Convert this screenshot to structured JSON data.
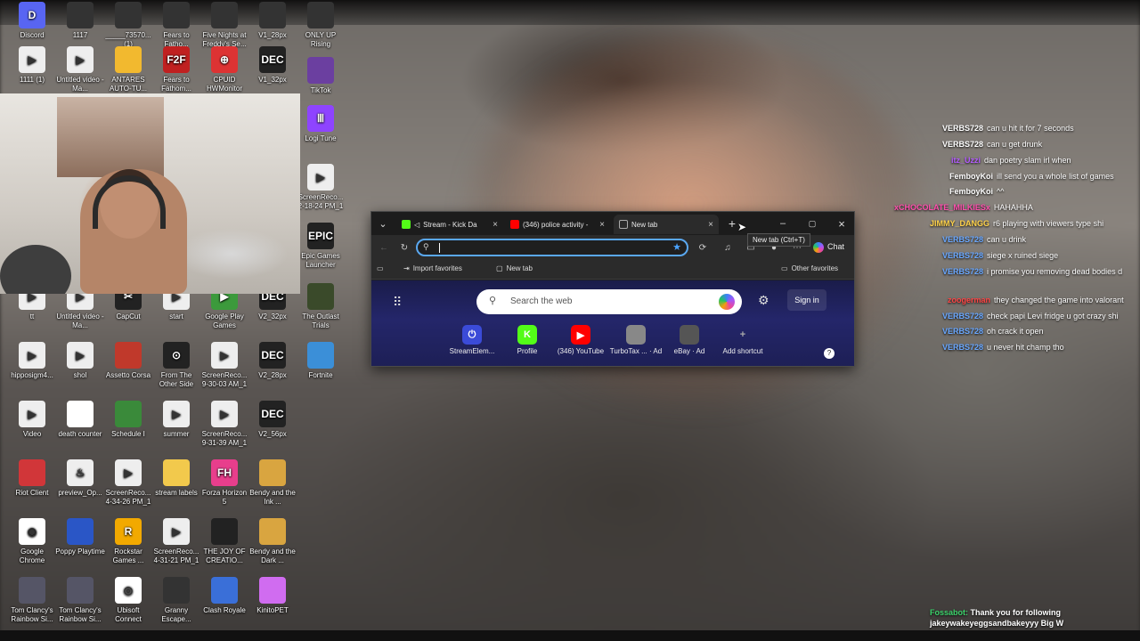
{
  "desktop": {
    "icons": [
      {
        "label": "Discord",
        "color": "#5865f2",
        "glyph": "D"
      },
      {
        "label": "1117",
        "color": "#333",
        "glyph": ""
      },
      {
        "label": "_____73570... (1)",
        "color": "#333",
        "glyph": ""
      },
      {
        "label": "Fears to Fatho...",
        "color": "#333",
        "glyph": ""
      },
      {
        "label": "Five Nights at Freddy's Se...",
        "color": "#333",
        "glyph": ""
      },
      {
        "label": "V1_28px",
        "color": "#333",
        "glyph": ""
      },
      {
        "label": "ONLY UP Rising",
        "color": "#333",
        "glyph": ""
      },
      {
        "label": "1111 (1)",
        "color": "#eee",
        "glyph": "▶"
      },
      {
        "label": "Untitled video - Ma...",
        "color": "#eee",
        "glyph": "▶"
      },
      {
        "label": "ANTARES AUTO-TU...",
        "color": "#f2b92f",
        "glyph": ""
      },
      {
        "label": "Fears to Fathom...",
        "color": "#c02020",
        "glyph": "F2F"
      },
      {
        "label": "CPUID HWMonitor",
        "color": "#d33",
        "glyph": "⊕"
      },
      {
        "label": "V1_32px",
        "color": "#222",
        "glyph": "DEC"
      },
      {
        "label": "TikTok",
        "color": "#6b3fa0",
        "glyph": ""
      },
      {
        "label": "Logi Tune",
        "color": "#8e44ff",
        "glyph": "Ⅲ"
      },
      {
        "label": "ScreenReco... 2-18-24 PM_1",
        "color": "#eee",
        "glyph": "▶"
      },
      {
        "label": "Epic Games Launcher",
        "color": "#222",
        "glyph": "EPIC"
      },
      {
        "label": "tt",
        "color": "#eee",
        "glyph": "▶"
      },
      {
        "label": "Untitled video - Ma...",
        "color": "#eee",
        "glyph": "▶"
      },
      {
        "label": "CapCut",
        "color": "#222",
        "glyph": "✂"
      },
      {
        "label": "start",
        "color": "#eee",
        "glyph": "▶"
      },
      {
        "label": "Google Play Games",
        "color": "#3c9a3c",
        "glyph": "▶"
      },
      {
        "label": "V2_32px",
        "color": "#222",
        "glyph": "DEC"
      },
      {
        "label": "The Outlast Trials",
        "color": "#3a4a2a",
        "glyph": ""
      },
      {
        "label": "hipposigm4...",
        "color": "#eee",
        "glyph": "▶"
      },
      {
        "label": "shol",
        "color": "#eee",
        "glyph": "▶"
      },
      {
        "label": "Assetto Corsa",
        "color": "#c0392b",
        "glyph": ""
      },
      {
        "label": "From The Other Side",
        "color": "#222",
        "glyph": "⊙"
      },
      {
        "label": "ScreenReco... 9-30-03 AM_1",
        "color": "#eee",
        "glyph": "▶"
      },
      {
        "label": "V2_28px",
        "color": "#222",
        "glyph": "DEC"
      },
      {
        "label": "Fortnite",
        "color": "#3b8fd8",
        "glyph": ""
      },
      {
        "label": "Video",
        "color": "#eee",
        "glyph": "▶"
      },
      {
        "label": "death counter",
        "color": "#fff",
        "glyph": ""
      },
      {
        "label": "Schedule I",
        "color": "#3a8a3a",
        "glyph": ""
      },
      {
        "label": "summer",
        "color": "#eee",
        "glyph": "▶"
      },
      {
        "label": "ScreenReco... 9-31-39 AM_1",
        "color": "#eee",
        "glyph": "▶"
      },
      {
        "label": "V2_56px",
        "color": "#222",
        "glyph": "DEC"
      },
      {
        "label": "Riot Client",
        "color": "#d13639",
        "glyph": ""
      },
      {
        "label": "preview_Op...",
        "color": "#eee",
        "glyph": "♨"
      },
      {
        "label": "ScreenReco... 4-34-26 PM_1",
        "color": "#eee",
        "glyph": "▶"
      },
      {
        "label": "stream labels",
        "color": "#f2c94c",
        "glyph": ""
      },
      {
        "label": "Forza Horizon 5",
        "color": "#e83e8c",
        "glyph": "FH"
      },
      {
        "label": "Bendy and the Ink ...",
        "color": "#d9a540",
        "glyph": ""
      },
      {
        "label": "Google Chrome",
        "color": "#fff",
        "glyph": "◉"
      },
      {
        "label": "Poppy Playtime",
        "color": "#2a56c6",
        "glyph": ""
      },
      {
        "label": "Rockstar Games ...",
        "color": "#f2a900",
        "glyph": "R"
      },
      {
        "label": "ScreenReco... 4-31-21 PM_1",
        "color": "#eee",
        "glyph": "▶"
      },
      {
        "label": "THE JOY OF CREATIO...",
        "color": "#222",
        "glyph": ""
      },
      {
        "label": "Bendy and the Dark ...",
        "color": "#d9a540",
        "glyph": ""
      },
      {
        "label": "Tom Clancy's Rainbow Si...",
        "color": "#556",
        "glyph": ""
      },
      {
        "label": "Tom Clancy's Rainbow Si...",
        "color": "#556",
        "glyph": ""
      },
      {
        "label": "Ubisoft Connect",
        "color": "#fff",
        "glyph": "◎"
      },
      {
        "label": "Granny Escape...",
        "color": "#333",
        "glyph": ""
      },
      {
        "label": "Clash Royale",
        "color": "#3a6fd8",
        "glyph": ""
      },
      {
        "label": "KinitoPET",
        "color": "#d06cf0",
        "glyph": ""
      }
    ]
  },
  "browser": {
    "tabs": [
      {
        "label": "Stream - Kick Da",
        "color": "#53fc18"
      },
      {
        "label": "(346) police activity -",
        "color": "#ff0000"
      },
      {
        "label": "New tab",
        "color": "#888"
      }
    ],
    "new_tab_tooltip": "New tab (Ctrl+T)",
    "address_value": "",
    "chat_label": "Chat",
    "favorites": {
      "import": "Import favorites",
      "new_tab": "New tab",
      "other": "Other favorites"
    },
    "ntp": {
      "search_placeholder": "Search the web",
      "sign_in": "Sign in",
      "quick_links": [
        {
          "label": "StreamElem...",
          "color": "#3b4bd8",
          "glyph": "⏻"
        },
        {
          "label": "Profile",
          "color": "#53fc18",
          "glyph": "K"
        },
        {
          "label": "(346) YouTube",
          "color": "#ff0000",
          "glyph": "▶"
        },
        {
          "label": "TurboTax ...",
          "ad": "Ad",
          "color": "#888",
          "glyph": ""
        },
        {
          "label": "eBay",
          "ad": "Ad",
          "color": "#555",
          "glyph": ""
        },
        {
          "label": "Add shortcut",
          "color": "transparent",
          "glyph": "+"
        }
      ]
    }
  },
  "chat": {
    "messages": [
      {
        "user": "VERBS728",
        "user_color": "#ffffff",
        "text": "can u hit it for 7 seconds"
      },
      {
        "user": "VERBS728",
        "user_color": "#ffffff",
        "text": "can u get drunk"
      },
      {
        "user": "itz_Uzzi",
        "user_color": "#b45cff",
        "text": "dan poetry slam irl when"
      },
      {
        "user": "FemboyKoi",
        "user_color": "#ffffff",
        "text": "ill send you a whole list of games"
      },
      {
        "user": "FemboyKoi",
        "user_color": "#ffffff",
        "text": "^^"
      },
      {
        "user": "xCHOCOLATE_MILKIESx",
        "user_color": "#ff4fae",
        "text": "HAHAHHA"
      },
      {
        "user": "JIMMY_DANGG",
        "user_color": "#ffd24a",
        "text": "r6 playing with viewers type shi"
      },
      {
        "user": "VERBS728",
        "user_color": "#6aa8ff",
        "text": "can u drink"
      },
      {
        "user": "VERBS728",
        "user_color": "#6aa8ff",
        "text": "siege x ruined siege"
      },
      {
        "user": "VERBS728",
        "user_color": "#6aa8ff",
        "text": "i promise you removing dead bodies d"
      },
      {
        "user": "zoogerman",
        "user_color": "#ff4444",
        "text": "they changed the game into valorant"
      },
      {
        "user": "VERBS728",
        "user_color": "#6aa8ff",
        "text": "check papi Levi fridge u got crazy shi"
      },
      {
        "user": "VERBS728",
        "user_color": "#6aa8ff",
        "text": "oh crack it open"
      },
      {
        "user": "VERBS728",
        "user_color": "#6aa8ff",
        "text": "u never hit champ tho"
      }
    ],
    "follow_prefix": "Fossabot:",
    "follow_text": "Thank you for following",
    "follow_name": "jakeywakeyeggsandbakeyyy Big W"
  }
}
